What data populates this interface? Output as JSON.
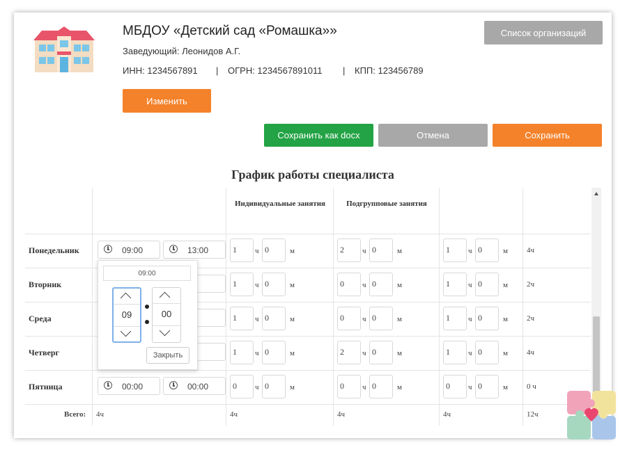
{
  "organization": {
    "name": "МБДОУ «Детский сад «Ромашка»»",
    "head": "Заведующий: Леонидов А.Г.",
    "inn": "ИНН: 1234567891",
    "ogrn": "ОГРН: 1234567891011",
    "kpp": "КПП: 123456789",
    "separator": "|"
  },
  "buttons": {
    "org_list": "Список организаций",
    "edit": "Изменить",
    "save_docx": "Сохранить как docx",
    "cancel": "Отмена",
    "save": "Сохранить"
  },
  "schedule": {
    "title": "График работы специалиста",
    "col_individual": "Индивидуальные занятия",
    "col_subgroup": "Подгрупповые занятия",
    "unit_hours": "ч",
    "unit_minutes": "м",
    "days": [
      {
        "name": "Понедельник",
        "start": "09:00",
        "end": "13:00",
        "ind_h": "1",
        "ind_m": "0",
        "sub_h": "2",
        "sub_m": "0",
        "oth_h": "1",
        "oth_m": "0",
        "total": "4ч"
      },
      {
        "name": "Вторник",
        "start": "",
        "end": "00",
        "ind_h": "1",
        "ind_m": "0",
        "sub_h": "0",
        "sub_m": "0",
        "oth_h": "1",
        "oth_m": "0",
        "total": "2ч"
      },
      {
        "name": "Среда",
        "start": "",
        "end": "00",
        "ind_h": "1",
        "ind_m": "0",
        "sub_h": "0",
        "sub_m": "0",
        "oth_h": "1",
        "oth_m": "0",
        "total": "2ч"
      },
      {
        "name": "Четверг",
        "start": "",
        "end": "00",
        "ind_h": "1",
        "ind_m": "0",
        "sub_h": "2",
        "sub_m": "0",
        "oth_h": "1",
        "oth_m": "0",
        "total": "4ч"
      },
      {
        "name": "Пятница",
        "start": "00:00",
        "end": "00:00",
        "ind_h": "0",
        "ind_m": "0",
        "sub_h": "0",
        "sub_m": "0",
        "oth_h": "0",
        "oth_m": "0",
        "total": "0 ч"
      }
    ],
    "totals": {
      "label": "Всего:",
      "time": "4ч",
      "individual": "4ч",
      "subgroup": "4ч",
      "other": "4ч",
      "grand": "12ч"
    }
  },
  "time_picker": {
    "header": "09:00",
    "hours": "09",
    "minutes": "00",
    "close_label": "Закрыть"
  },
  "colors": {
    "orange": "#f4822a",
    "green": "#23a345",
    "gray": "#a8a8a8"
  }
}
